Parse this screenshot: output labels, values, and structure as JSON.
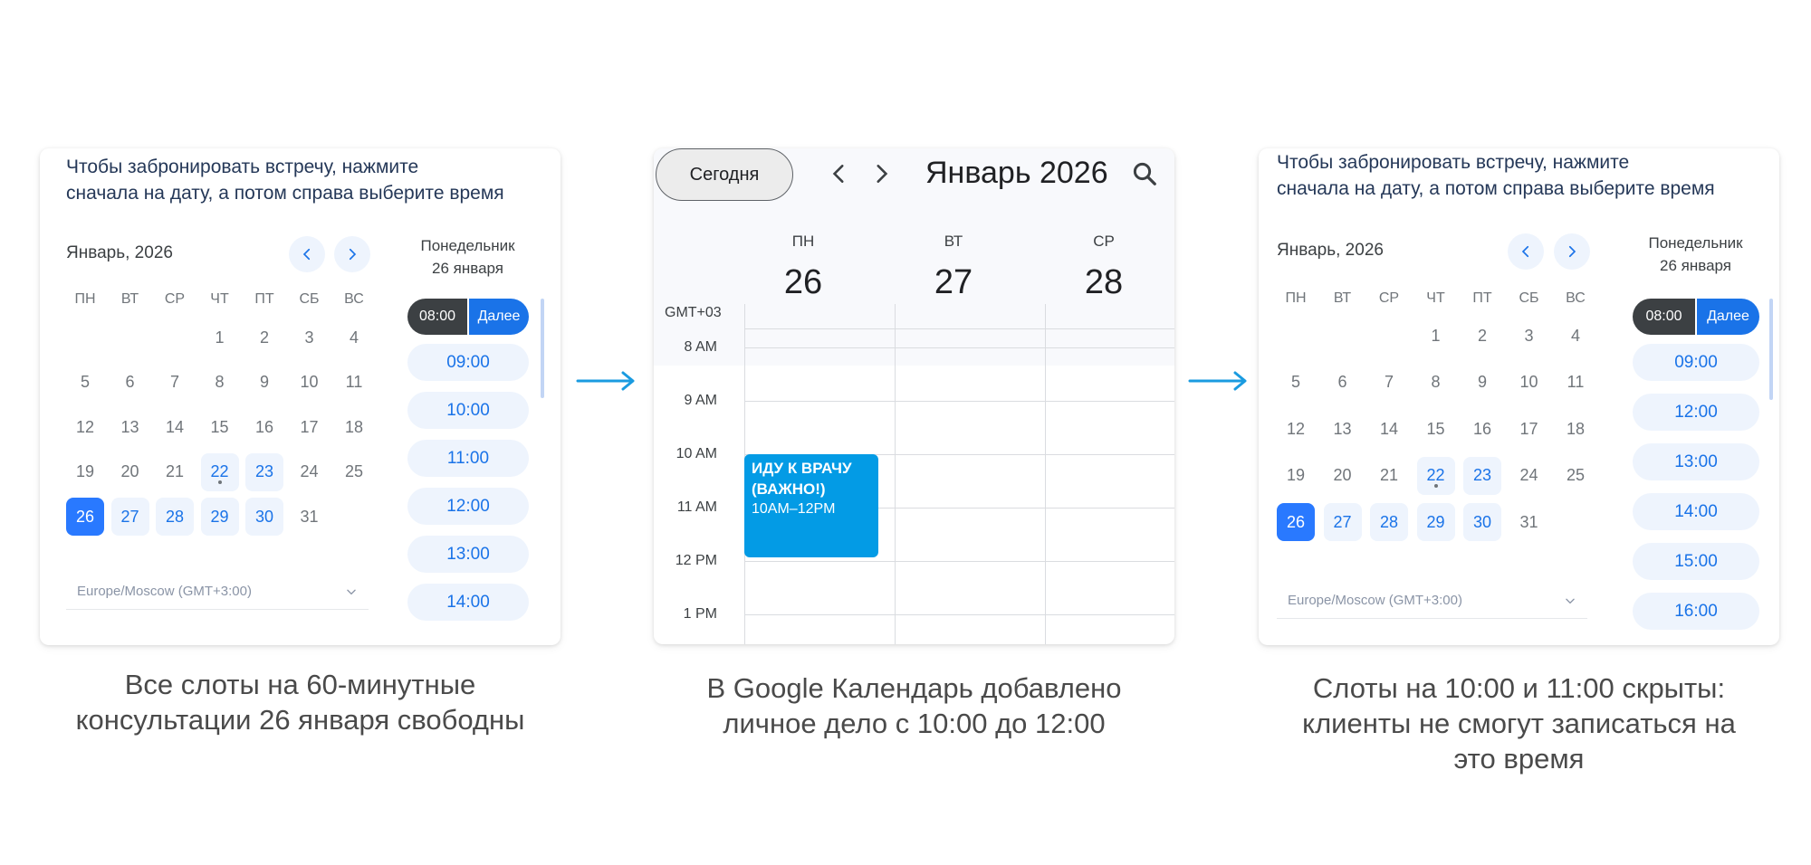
{
  "left_widget": {
    "instruction": [
      "Чтобы забронировать встречу, нажмите",
      "сначала на дату, а потом справа выберите время"
    ],
    "month": "Январь, 2026",
    "weekdays": [
      "ПН",
      "ВТ",
      "СР",
      "ЧТ",
      "ПТ",
      "СБ",
      "ВС"
    ],
    "timezone": "Europe/Moscow (GMT+3:00)",
    "day_label": [
      "Понедельник",
      "26 января"
    ],
    "selected_slot": {
      "time": "08:00",
      "next": "Далее"
    },
    "slots": [
      "09:00",
      "10:00",
      "11:00",
      "12:00",
      "13:00",
      "14:00"
    ]
  },
  "calendar_days": [
    [
      "",
      "",
      "",
      "1",
      "2",
      "3",
      "4"
    ],
    [
      "5",
      "6",
      "7",
      "8",
      "9",
      "10",
      "11"
    ],
    [
      "12",
      "13",
      "14",
      "15",
      "16",
      "17",
      "18"
    ],
    [
      "19",
      "20",
      "21",
      "22",
      "23",
      "24",
      "25"
    ],
    [
      "26",
      "27",
      "28",
      "29",
      "30",
      "31",
      ""
    ]
  ],
  "calendar_available_days": [
    "22",
    "23",
    "27",
    "28",
    "29",
    "30"
  ],
  "calendar_selected_day": "26",
  "calendar_today_day": "22",
  "google_calendar": {
    "today_button": "Сегодня",
    "title": "Январь 2026",
    "columns": [
      {
        "dow": "ПН",
        "date": "26"
      },
      {
        "dow": "ВТ",
        "date": "27"
      },
      {
        "dow": "СР",
        "date": "28"
      }
    ],
    "timezone_label": "GMT+03",
    "hours": [
      "8 AM",
      "9 AM",
      "10 AM",
      "11 AM",
      "12 PM",
      "1 PM"
    ],
    "event": {
      "title_line1": "ИДУ К ВРАЧУ",
      "title_line2": "(ВАЖНО!)",
      "time": "10AM–12PM"
    }
  },
  "right_widget": {
    "instruction": [
      "Чтобы забронировать встречу, нажмите",
      "сначала на дату, а потом справа выберите время"
    ],
    "month": "Январь, 2026",
    "weekdays": [
      "ПН",
      "ВТ",
      "СР",
      "ЧТ",
      "ПТ",
      "СБ",
      "ВС"
    ],
    "timezone": "Europe/Moscow (GMT+3:00)",
    "day_label": [
      "Понедельник",
      "26 января"
    ],
    "selected_slot": {
      "time": "08:00",
      "next": "Далее"
    },
    "slots": [
      "09:00",
      "12:00",
      "13:00",
      "14:00",
      "15:00",
      "16:00"
    ]
  },
  "captions": {
    "left": [
      "Все слоты на 60-минутные",
      "консультации 26 января свободны"
    ],
    "middle": [
      "В Google Календарь добавлено",
      "личное дело с 10:00 до 12:00"
    ],
    "right": [
      "Слоты на 10:00 и 11:00 скрыты:",
      "клиенты не смогут записаться на",
      "это время"
    ]
  },
  "colors": {
    "accent": "#1a73e8",
    "selected": "#2979ff",
    "available_bg": "#eef4fd",
    "event": "#039be5",
    "arrow": "#1a9be0"
  }
}
